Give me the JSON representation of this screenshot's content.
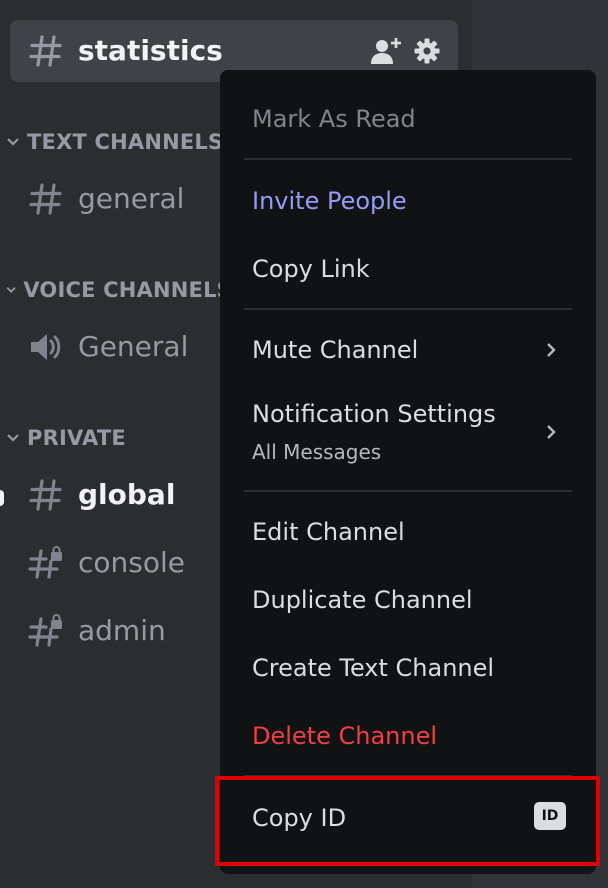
{
  "sidebar": {
    "selected_channel": {
      "name": "statistics",
      "icons": [
        "add-member-icon",
        "gear-icon"
      ]
    },
    "categories": [
      {
        "label": "TEXT CHANNELS",
        "channels": [
          {
            "name": "general",
            "icon": "hash-icon"
          }
        ]
      },
      {
        "label": "VOICE CHANNELS",
        "channels": [
          {
            "name": "General",
            "icon": "speaker-icon"
          }
        ]
      },
      {
        "label": "PRIVATE",
        "channels": [
          {
            "name": "global",
            "icon": "hash-icon",
            "unread": true
          },
          {
            "name": "console",
            "icon": "locked-hash-icon"
          },
          {
            "name": "admin",
            "icon": "locked-hash-icon"
          }
        ]
      }
    ]
  },
  "context_menu": {
    "mark_as_read": "Mark As Read",
    "invite_people": "Invite People",
    "copy_link": "Copy Link",
    "mute_channel": "Mute Channel",
    "notification_settings": "Notification Settings",
    "notification_settings_value": "All Messages",
    "edit_channel": "Edit Channel",
    "duplicate_channel": "Duplicate Channel",
    "create_text_channel": "Create Text Channel",
    "delete_channel": "Delete Channel",
    "copy_id": "Copy ID",
    "copy_id_badge": "ID"
  },
  "colors": {
    "sidebar_bg": "#2b2d31",
    "menu_bg": "#111214",
    "accent_blue": "#949cf7",
    "danger_red": "#f23f43",
    "highlight_red": "#e00000"
  }
}
